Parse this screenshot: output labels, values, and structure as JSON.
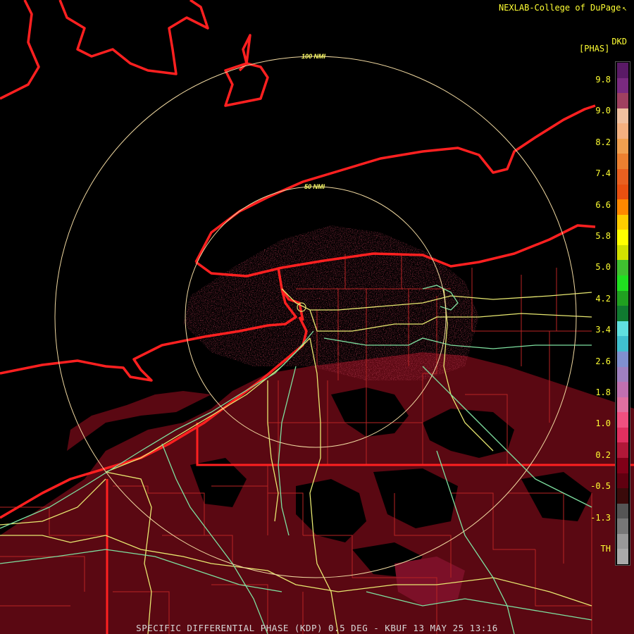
{
  "header": {
    "credit": "NEXLAB-College of DuPage",
    "credit_icon": "radar-logo-icon"
  },
  "legend": {
    "product": "DKD",
    "unit": "[PHAS]",
    "ticks": [
      "9.8",
      "9.0",
      "8.2",
      "7.4",
      "6.6",
      "5.8",
      "5.0",
      "4.2",
      "3.4",
      "2.6",
      "1.8",
      "1.0",
      "0.2",
      "-0.5",
      "-1.3",
      "TH"
    ],
    "colors": [
      "#5a1a66",
      "#7a2a80",
      "#a04060",
      "#f0c0a0",
      "#f4b080",
      "#f0a050",
      "#ec8030",
      "#e86020",
      "#e85010",
      "#ff8800",
      "#ffcc00",
      "#ffff00",
      "#d0e000",
      "#40c030",
      "#20e020",
      "#20a020",
      "#107a30",
      "#60e0e0",
      "#40c0d0",
      "#8090d0",
      "#a080c0",
      "#c070b0",
      "#e070a0",
      "#f05080",
      "#e03060",
      "#b01838",
      "#800018",
      "#600010",
      "#3a0a0a",
      "#555555",
      "#777777",
      "#999999",
      "#aaaaaa"
    ]
  },
  "map": {
    "rings": [
      {
        "label": "100 NMI"
      },
      {
        "label": "50 NMI"
      }
    ],
    "colors": {
      "border": "#ff2020",
      "county": "#cc2a2a",
      "highway_yellow": "#e8e870",
      "highway_green": "#7ee0a0",
      "ring": "#f0d8a0",
      "echo": "#6a0a14"
    }
  },
  "footer": {
    "caption": "SPECIFIC DIFFERENTIAL PHASE (KDP) 0.5 DEG - KBUF 13 MAY 25 13:16"
  }
}
